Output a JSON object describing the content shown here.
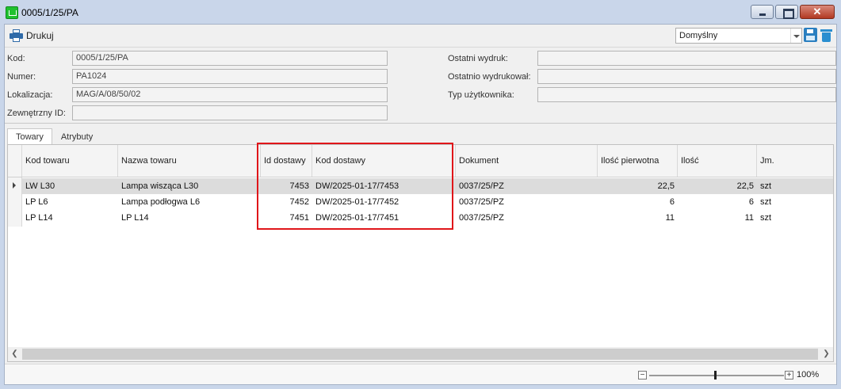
{
  "window": {
    "title": "0005/1/25/PA"
  },
  "toolbar": {
    "print_label": "Drukuj",
    "layout_value": "Domyślny"
  },
  "form": {
    "kod_label": "Kod:",
    "kod_value": "0005/1/25/PA",
    "numer_label": "Numer:",
    "numer_value": "PA1024",
    "lokalizacja_label": "Lokalizacja:",
    "lokalizacja_value": "MAG/A/08/50/02",
    "zewnetrzny_label": "Zewnętrzny ID:",
    "zewnetrzny_value": "",
    "ostatni_wydruk_label": "Ostatni wydruk:",
    "ostatni_wydruk_value": "",
    "ostatnio_wydrukowal_label": "Ostatnio wydrukował:",
    "ostatnio_wydrukowal_value": "",
    "typ_uzytkownika_label": "Typ użytkownika:",
    "typ_uzytkownika_value": ""
  },
  "tabs": [
    {
      "label": "Towary",
      "active": true
    },
    {
      "label": "Atrybuty",
      "active": false
    }
  ],
  "grid": {
    "columns": [
      "Kod towaru",
      "Nazwa towaru",
      "Id dostawy",
      "Kod dostawy",
      "Dokument",
      "Ilość pierwotna",
      "Ilość",
      "Jm."
    ],
    "rows": [
      {
        "kod": "LW L30",
        "nazwa": "Lampa wisząca L30",
        "id": "7453",
        "kod_dostawy": "DW/2025-01-17/7453",
        "dokument": "0037/25/PZ",
        "ilosc_pierwotna": "22,5",
        "ilosc": "22,5",
        "jm": "szt",
        "selected": true
      },
      {
        "kod": "LP L6",
        "nazwa": "Lampa podłogwa L6",
        "id": "7452",
        "kod_dostawy": "DW/2025-01-17/7452",
        "dokument": "0037/25/PZ",
        "ilosc_pierwotna": "6",
        "ilosc": "6",
        "jm": "szt",
        "selected": false
      },
      {
        "kod": "LP L14",
        "nazwa": "LP L14",
        "id": "7451",
        "kod_dostawy": "DW/2025-01-17/7451",
        "dokument": "0037/25/PZ",
        "ilosc_pierwotna": "11",
        "ilosc": "11",
        "jm": "szt",
        "selected": false
      }
    ]
  },
  "status": {
    "zoom_percent": "100%",
    "zoom_minus": "−",
    "zoom_plus": "+"
  },
  "colors": {
    "highlight": "#e0161a",
    "selected_row": "#dcdcdc",
    "accent_blue": "#2a7fc0"
  }
}
